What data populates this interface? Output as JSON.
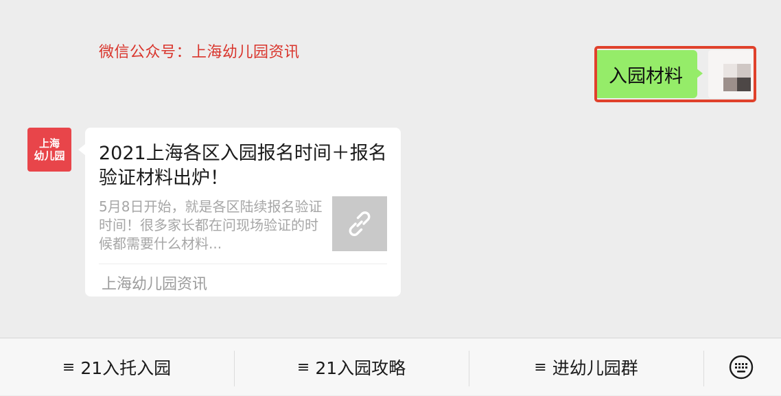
{
  "header": {
    "note": "微信公众号：上海幼儿园资讯"
  },
  "outgoing": {
    "text": "入园材料",
    "bubble_color": "#95ec69",
    "highlight_color": "#e0412b",
    "avatar_icon": "pixelated-avatar"
  },
  "incoming": {
    "avatar": {
      "line1": "上海",
      "line2": "幼儿园",
      "color": "#e8454a"
    },
    "card": {
      "title": "2021上海各区入园报名时间＋报名验证材料出炉！",
      "description": "5月8日开始，就是各区陆续报名验证时间！很多家长都在问现场验证的时候都需要什么材料...",
      "thumb_icon": "link-icon",
      "source": "上海幼儿园资讯"
    }
  },
  "menu": {
    "items": [
      {
        "icon": "≡",
        "label": "21入托入园"
      },
      {
        "icon": "≡",
        "label": "21入园攻略"
      },
      {
        "icon": "≡",
        "label": "进幼儿园群"
      }
    ],
    "keyboard_icon": "keyboard-icon"
  }
}
